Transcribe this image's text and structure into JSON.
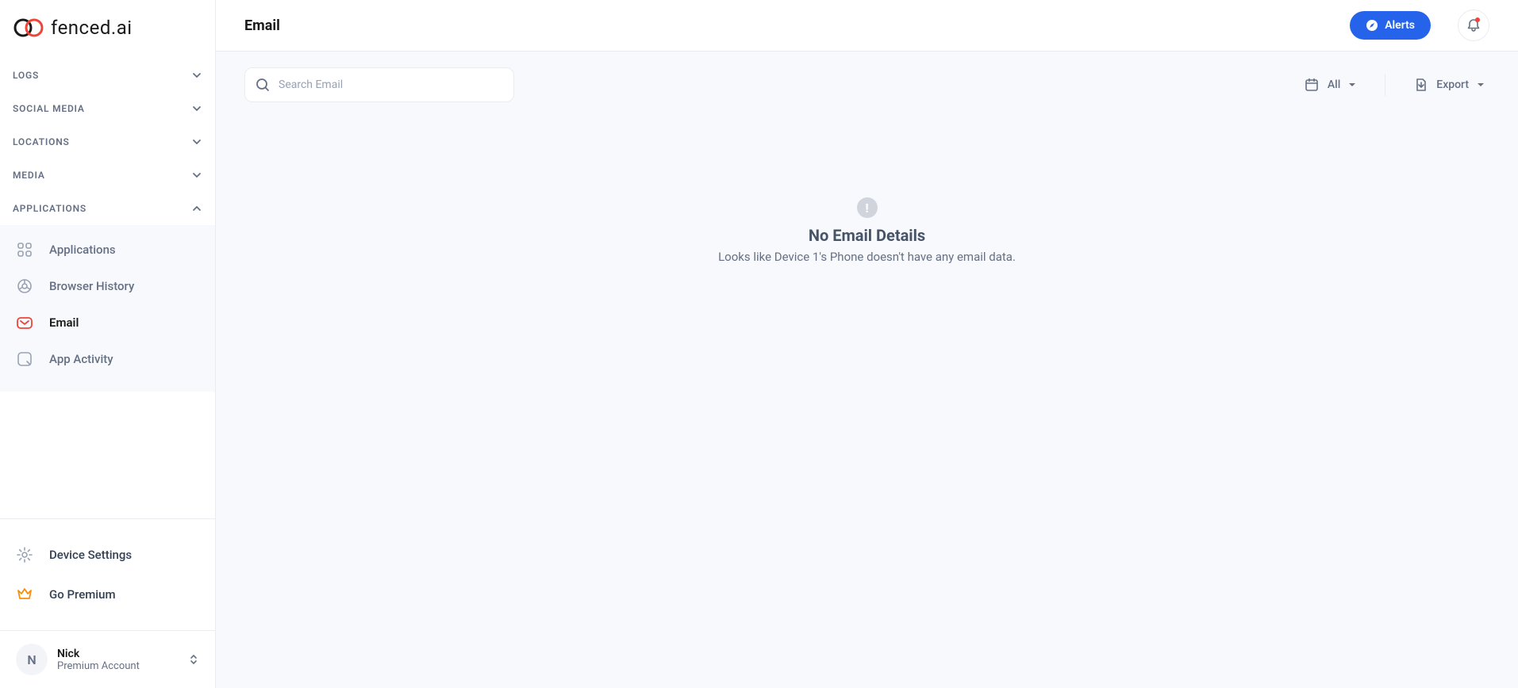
{
  "brand": {
    "name": "fenced.ai"
  },
  "sidebar": {
    "sections": [
      {
        "label": "LOGS",
        "expanded": false
      },
      {
        "label": "SOCIAL MEDIA",
        "expanded": false
      },
      {
        "label": "LOCATIONS",
        "expanded": false
      },
      {
        "label": "MEDIA",
        "expanded": false
      },
      {
        "label": "APPLICATIONS",
        "expanded": true
      }
    ],
    "app_items": [
      {
        "label": "Applications",
        "icon": "apps-icon",
        "active": false
      },
      {
        "label": "Browser History",
        "icon": "browser-icon",
        "active": false
      },
      {
        "label": "Email",
        "icon": "email-icon",
        "active": true
      },
      {
        "label": "App Activity",
        "icon": "activity-icon",
        "active": false
      }
    ],
    "bottom": {
      "settings": "Device Settings",
      "premium": "Go Premium"
    },
    "user": {
      "initial": "N",
      "name": "Nick",
      "plan": "Premium Account"
    }
  },
  "header": {
    "title": "Email",
    "alerts_label": "Alerts"
  },
  "toolbar": {
    "search_placeholder": "Search Email",
    "filter_label": "All",
    "export_label": "Export"
  },
  "empty_state": {
    "icon": "!",
    "title": "No Email Details",
    "subtitle": "Looks like Device 1's Phone doesn't have any email data."
  }
}
